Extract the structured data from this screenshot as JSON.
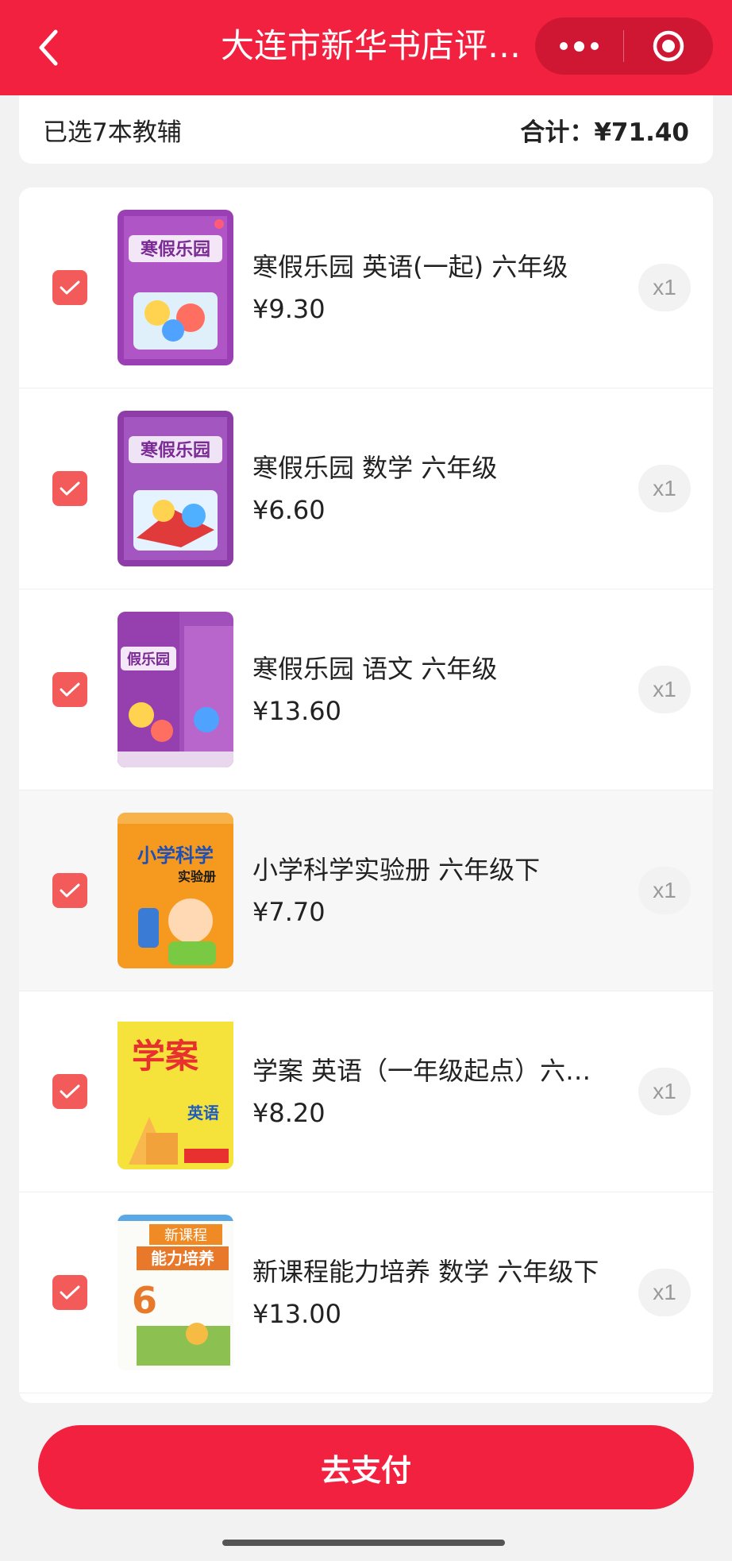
{
  "header": {
    "title": "大连市新华书店评…",
    "bg_color": "#f2213f"
  },
  "summary": {
    "selected_text": "已选7本教辅",
    "total_text": "合计：¥71.40"
  },
  "items": [
    {
      "name": "寒假乐园 英语(一起) 六年级",
      "price": "¥9.30",
      "qty": "x1",
      "cover": "purple-english",
      "cover_title": "寒假乐园"
    },
    {
      "name": "寒假乐园 数学 六年级",
      "price": "¥6.60",
      "qty": "x1",
      "cover": "purple-math",
      "cover_title": "寒假乐园"
    },
    {
      "name": "寒假乐园 语文 六年级",
      "price": "¥13.60",
      "qty": "x1",
      "cover": "purple-chinese",
      "cover_title": "假乐园"
    },
    {
      "name": "小学科学实验册 六年级下",
      "price": "¥7.70",
      "qty": "x1",
      "cover": "orange-science",
      "cover_title": "小学科学",
      "cover_sub": "实验册"
    },
    {
      "name": "学案 英语（一年级起点）六…",
      "price": "¥8.20",
      "qty": "x1",
      "cover": "yellow-xuean",
      "cover_title": "学案",
      "cover_sub": "英语"
    },
    {
      "name": "新课程能力培养 数学 六年级下",
      "price": "¥13.00",
      "qty": "x1",
      "cover": "white-xinkecheng",
      "cover_title": "新课程",
      "cover_sub": "能力培养"
    }
  ],
  "pay_button": {
    "label": "去支付"
  },
  "icons": {
    "back": "chevron-left-icon",
    "more": "more-dots-icon",
    "target": "target-circle-icon",
    "check": "checkmark-icon"
  }
}
